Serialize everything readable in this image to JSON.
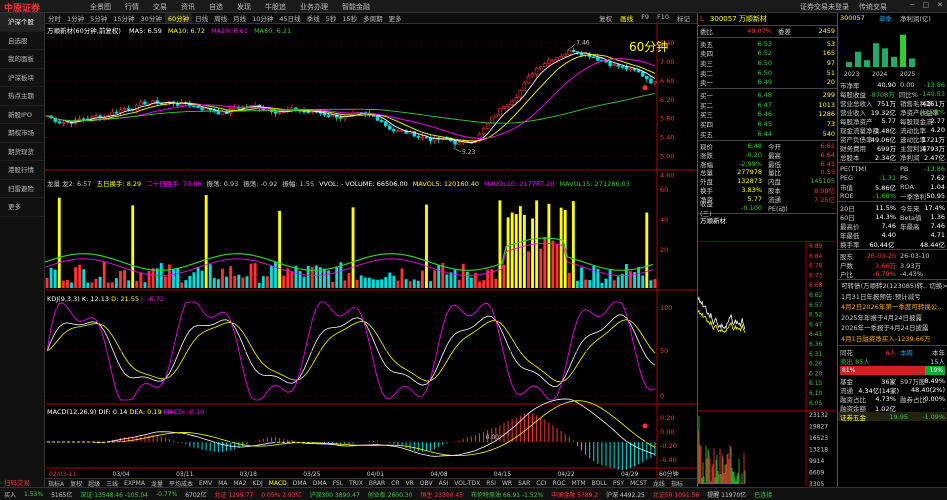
{
  "topbar": {
    "logo": "中原证券",
    "menu": [
      "全景图",
      "行情",
      "交易",
      "资讯",
      "自选",
      "发现",
      "牛股追",
      "业务办理",
      "智能金融"
    ],
    "right": [
      "证券交易未登录",
      "传统交易"
    ],
    "win": [
      "─",
      "□",
      "✕"
    ]
  },
  "sidebar": [
    "沪深个股",
    "自选股",
    "我的面板",
    "沪深板块",
    "热点主题",
    "新股IPO",
    "期权市场",
    "期货现货",
    "港股行情",
    "扫雷避险",
    "更多"
  ],
  "sidebar_bottom": "扫码交易",
  "periods": [
    "分时",
    "1分钟",
    "5分钟",
    "15分钟",
    "30分钟",
    "60分钟",
    "日线",
    "周线",
    "月线",
    "10分钟",
    "45日线",
    "季线",
    "5秒",
    "15秒",
    "多周期",
    "更多"
  ],
  "period_selected": "60分钟",
  "tools": [
    "复权",
    "画线",
    "F9",
    "F10",
    "标记"
  ],
  "main": {
    "title": "万顺新材(60分钟,前复权)",
    "ma": [
      {
        "k": "MA5: 6.59",
        "c": "#fff"
      },
      {
        "k": "MA10: 6.72",
        "c": "#ff0"
      },
      {
        "k": "MA20: 6.61",
        "c": "#f0f"
      },
      {
        "k": "MA60: 6.21",
        "c": "#3c3"
      }
    ],
    "big_label": "60分钟",
    "high": "7.46",
    "low": "5.23",
    "ticks": [
      "7.40",
      "7.00",
      "6.60",
      "6.20",
      "5.80",
      "5.40",
      "5.00",
      "4.60"
    ]
  },
  "vol": {
    "parts": [
      {
        "t": "龙量 龙2: 6.57",
        "c": "#ccc"
      },
      {
        "t": "五日换手: 8.29",
        "c": "#ff0"
      },
      {
        "t": "二十日换手: 70.86",
        "c": "#f0f"
      },
      {
        "t": "振荡: 0.93",
        "c": "#ccc"
      },
      {
        "t": "振荡: -0.92",
        "c": "#ccc"
      },
      {
        "t": "振幅: 1.55",
        "c": "#ccc"
      },
      {
        "t": "VVOL: - VOLUME: 66506.00",
        "c": "#fff"
      },
      {
        "t": "MAVOL5: 120160.40",
        "c": "#ff0"
      },
      {
        "t": "MAVOL10: 217787.20",
        "c": "#f0f"
      },
      {
        "t": "MAVOL15: 271286.03",
        "c": "#3c3"
      }
    ],
    "ticks": [
      "60",
      "40",
      "20"
    ]
  },
  "kdj": {
    "label": "KDJ(9,3,3)",
    "k": "K: 12.13",
    "d": "D: 21.55",
    "j": "J: -6.72",
    "ticks": [
      "100",
      "50",
      "0"
    ]
  },
  "macd": {
    "label": "MACD(12,26,9)",
    "dif": "DIF: 0.14",
    "dea": "DEA: 0.19",
    "macd": "MACD: -0.10",
    "zero": "0.00",
    "ticks": [
      "0.20",
      "0.00",
      "-0.20",
      "-0.40"
    ]
  },
  "xaxis": {
    "ticks": [
      "02/03-11",
      "03/04",
      "03/11",
      "03/18",
      "03/25",
      "04/01",
      "04/08",
      "04/15",
      "04/22",
      "04/29"
    ],
    "end": "60分钟"
  },
  "bottomtabs": [
    "指标A",
    "复权",
    "超级",
    "三线",
    "EXPMA",
    "龙量",
    "平均成本",
    "EMV",
    "MA",
    "MA2",
    "KDJ",
    "MACD",
    "DMA",
    "DMA",
    "FSL",
    "TRIX",
    "BRAR",
    "CR",
    "VR",
    "OBV",
    "ASI",
    "VOL-TDX",
    "RSI",
    "WR",
    "SAR",
    "CCI",
    "ROC",
    "MTM",
    "BOLL",
    "PSY",
    "MCST",
    "龙线",
    "指标"
  ],
  "bottomtabs_sel": "MACD",
  "footer": [
    {
      "t": "买入",
      "c": "#ccc"
    },
    {
      "t": "1.53%",
      "c": "#3c3"
    },
    {
      "t": "5165亿",
      "c": "#ccc"
    },
    {
      "t": "深证 13548.46 -105.04",
      "c": "#3c3"
    },
    {
      "t": "-0.77%",
      "c": "#3c3"
    },
    {
      "t": "6702亿",
      "c": "#ccc"
    },
    {
      "t": "北证 1299.77",
      "c": "#f33"
    },
    {
      "t": "0.05% 2.93亿",
      "c": "#f33"
    },
    {
      "t": "沪深300 3890.47",
      "c": "#3c3"
    },
    {
      "t": "创业板 2600.30",
      "c": "#3c3"
    },
    {
      "t": "恒生 23300.45",
      "c": "#f33"
    },
    {
      "t": "布伦特原油 66.91 -1.52%",
      "c": "#3c3"
    },
    {
      "t": "中国金融 5789.2",
      "c": "#f33"
    },
    {
      "t": "沪深 4492.25",
      "c": "#ccc"
    },
    {
      "t": "北证50 1091.56",
      "c": "#f33"
    },
    {
      "t": "提醒 11970亿",
      "c": "#ccc"
    },
    {
      "t": "已连接",
      "c": "#3c3"
    }
  ],
  "quote": {
    "code": "300057",
    "name": "万顺新材",
    "weibi": "委比",
    "weibi_v": "49.07%",
    "weicha": "委差",
    "weicha_v": "2459",
    "sells": [
      [
        "卖五",
        "6.53",
        "53"
      ],
      [
        "卖四",
        "6.52",
        "165"
      ],
      [
        "卖三",
        "6.50",
        "97"
      ],
      [
        "卖二",
        "6.50",
        "51"
      ],
      [
        "卖一",
        "6.49",
        "20"
      ]
    ],
    "buys": [
      [
        "买一",
        "6.48",
        "299"
      ],
      [
        "买二",
        "6.47",
        "1013"
      ],
      [
        "买三",
        "6.46",
        "1286"
      ],
      [
        "买四",
        "6.45",
        "73"
      ],
      [
        "买五",
        "6.44",
        "540"
      ]
    ],
    "stats": [
      [
        "现价",
        "6.48",
        "今开",
        "6.61"
      ],
      [
        "涨跌",
        "-0.20",
        "最高",
        "6.64"
      ],
      [
        "涨幅",
        "-2.99%",
        "最低",
        "6.41"
      ],
      [
        "总量",
        "277978",
        "量比",
        "0.53"
      ],
      [
        "外盘",
        "132873",
        "内盘",
        "145105"
      ],
      [
        "换手",
        "3.83%",
        "股本",
        "8.98亿"
      ],
      [
        "净资",
        "5.77",
        "流通",
        "7.25亿"
      ],
      [
        "收益(三)",
        "-0.100",
        "PE(动)",
        "-"
      ]
    ],
    "tick_title": "万顺新材",
    "tick_ticks": [
      "6.89",
      "6.84",
      "6.78",
      "6.73",
      "6.68",
      "6.62",
      "6.57",
      "6.52",
      "6.47",
      "6.41",
      "6.36",
      "6.31",
      "6.26",
      "6.20",
      "6.15",
      "6.10",
      "6.05"
    ],
    "vol_ticks": [
      "23132",
      "19827",
      "16523",
      "13218",
      "9914",
      "6609",
      "3305"
    ]
  },
  "right": {
    "code": "300057",
    "tabs": [
      "单季",
      "净利润(亿)"
    ],
    "years": [
      "2023",
      "2024",
      "2025"
    ],
    "fin": [
      [
        "市净率",
        "40.90",
        "0.00",
        "-13.86"
      ],
      [
        "每股收益",
        "-8708万",
        "同比%",
        "-140.53"
      ],
      [
        "营业总收入",
        "751万",
        "销售毛利率",
        "4261万"
      ],
      [
        "营业收入",
        "19.32亿",
        "净资产收益率",
        "-2.22%"
      ],
      [
        "每股净资产",
        "5.77",
        "每股现金流",
        "2.77"
      ],
      [
        "现金流量净额",
        "1.48亿",
        "流动比率",
        "4.20"
      ],
      [
        "资产负债率",
        "49.06亿",
        "速动比率",
        "1721万"
      ],
      [
        "财务费用",
        "699万",
        "主营利润",
        "4793万"
      ],
      [
        "总股本",
        "2.34亿",
        "净利润",
        "2.47亿"
      ]
    ],
    "pe": [
      [
        "PE(TTM)",
        "-",
        "PB",
        "-13.86"
      ],
      [
        "PEG",
        "-1.31",
        "PS",
        "7.62"
      ],
      [
        "市值",
        "5.86亿",
        "ROA",
        "1.04"
      ],
      [
        "ROE",
        "-1.68%",
        "一季净利",
        "50.95"
      ]
    ],
    "perf": [
      [
        "20日",
        "11.5%",
        "今年来",
        "17.4%"
      ],
      [
        "60日",
        "14.3%",
        "Beta值",
        "1.36"
      ],
      [
        "最高价",
        "7.46",
        "年最高",
        "7.46"
      ],
      [
        "年最低",
        "4.40",
        "",
        "4.71"
      ],
      [
        "换手率",
        "60.44亿",
        "",
        "48.44亿"
      ]
    ],
    "dates": [
      [
        "股东",
        "26-03-20",
        "26-03-10"
      ],
      [
        "户数",
        "3.66万",
        "3.93万"
      ],
      [
        "户比",
        "-6.78%",
        "-4.43%"
      ]
    ],
    "news_title": "可转债(万顺转2(123085)转.. 切换>",
    "news": [
      {
        "t": "1月31日年报预告:预计减亏",
        "c": "#ccc"
      },
      {
        "t": "4月2日2026年第一季度可转换公..",
        "c": "#fa0"
      },
      {
        "t": "2025年年报于4月24日披露",
        "c": "#ccc"
      },
      {
        "t": "2026年一季报于4月24日披露",
        "c": "#ccc"
      },
      {
        "t": "4月1日融资净买入-1239.66万",
        "c": "#fa0"
      }
    ],
    "ths_label": "同花",
    "ths_vals": [
      "6人",
      "本周",
      "本年"
    ],
    "ths_row": [
      "卖出 85人",
      "",
      "15人"
    ],
    "bar_pct": "81%",
    "bar_pct2": "19%",
    "extra": [
      [
        "基金",
        "36家",
        "597万股",
        "8.49%"
      ],
      [
        "流通",
        "4.34亿(14家)",
        "",
        "48.40(2%)"
      ],
      [
        "融资占比",
        "4.73%",
        "融券占比",
        "0.00%"
      ],
      [
        "融资余额",
        "1.02亿",
        "",
        "-"
      ]
    ],
    "bottom_name": "证券五金",
    "bottom_vals": [
      "19.95",
      "-1.09%"
    ]
  }
}
